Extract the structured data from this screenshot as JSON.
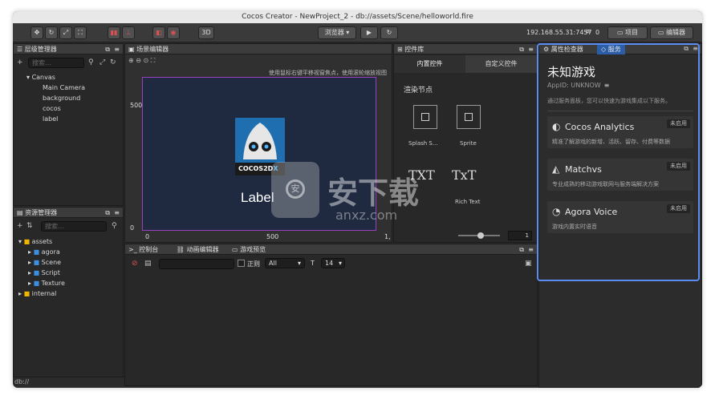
{
  "window": {
    "title": "Cocos Creator - NewProject_2 - db://assets/Scene/helloworld.fire"
  },
  "toolbar": {
    "browser_label": "浏览器 ▾",
    "ip_label": "192.168.55.31:7457",
    "count": "0",
    "project_label": "项目",
    "editor_label": "编辑器",
    "mode_3d": "3D"
  },
  "hierarchy": {
    "title": "层级管理器",
    "search_placeholder": "搜索...",
    "root": "Canvas",
    "children": [
      "Main Camera",
      "background",
      "cocos",
      "label"
    ]
  },
  "assets": {
    "title": "资源管理器",
    "search_placeholder": "搜索...",
    "root": "assets",
    "folders": [
      "agora",
      "Scene",
      "Script",
      "Texture"
    ],
    "internal": "internal",
    "status": "db://"
  },
  "scene": {
    "title": "场景编辑器",
    "hint": "使用鼠标右键平移视窗焦点，使用滚轮缩放视图",
    "label_text": "Label",
    "logo_text": "COCOS2D",
    "logo_suffix": "X",
    "y_tick_500": "500",
    "y_tick_0": "0",
    "x_tick_0": "0",
    "x_tick_500": "500",
    "x_tick_1": "1,"
  },
  "library": {
    "title": "控件库",
    "tab_builtin": "内置控件",
    "tab_custom": "自定义控件",
    "section": "渲染节点",
    "items": [
      "Splash S...",
      "Sprite",
      "",
      "Rich Text"
    ],
    "txt_label": "TXT",
    "txt_rich": "TxT",
    "slider_value": "1"
  },
  "console": {
    "tab_console": "控制台",
    "tab_anim": "动画编辑器",
    "tab_preview": "游戏预览",
    "regex_label": "正则",
    "filter_value": "All",
    "font_size": "14"
  },
  "inspector": {
    "tab_properties": "属性检查器",
    "tab_services": "服务",
    "game_title": "未知游戏",
    "app_id": "AppID: UNKNOW",
    "description": "通过服务面板，您可以快速为游戏集成以下服务。",
    "services": [
      {
        "name": "Cocos Analytics",
        "badge": "未启用",
        "desc": "精准了解游戏的新增、活跃、留存、付费等数据"
      },
      {
        "name": "Matchvs",
        "badge": "未启用",
        "desc": "专业成熟的移动游戏联网与服务端解决方案"
      },
      {
        "name": "Agora Voice",
        "badge": "未启用",
        "desc": "游戏内置实时语音"
      }
    ]
  },
  "watermark": {
    "text": "安下载",
    "sub": "anxz.com"
  },
  "colors": {
    "highlight": "#5b8df0",
    "scene_bg": "#1f2a40",
    "canvas_border": "#9b3fc2"
  }
}
